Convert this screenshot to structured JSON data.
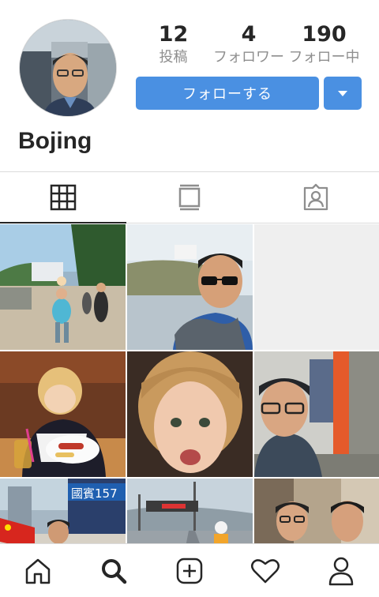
{
  "profile": {
    "username": "Bojing",
    "stats": [
      {
        "value": "12",
        "label": "投稿"
      },
      {
        "value": "4",
        "label": "フォロワー"
      },
      {
        "value": "190",
        "label": "フォロー中"
      }
    ],
    "follow_label": "フォローする"
  },
  "tabs": [
    "grid-icon",
    "feed-icon",
    "tagged-icon"
  ],
  "grid": {
    "photos": [
      {
        "name": "photo-park-child",
        "sign_text": ""
      },
      {
        "name": "photo-selfie-sunglasses",
        "sign_text": ""
      },
      {
        "name": "photo-empty",
        "sign_text": ""
      },
      {
        "name": "photo-child-eating",
        "sign_text": ""
      },
      {
        "name": "photo-child-face",
        "sign_text": ""
      },
      {
        "name": "photo-selfie-glasses",
        "sign_text": ""
      },
      {
        "name": "photo-city-flag",
        "sign_text": "國賓157"
      },
      {
        "name": "photo-bridge-road",
        "sign_text": ""
      },
      {
        "name": "photo-two-men",
        "sign_text": ""
      }
    ]
  },
  "bottom_nav": [
    "home-icon",
    "search-icon",
    "add-post-icon",
    "activity-heart-icon",
    "profile-icon"
  ],
  "colors": {
    "accent": "#4a90e2",
    "text": "#262626",
    "muted": "#8e8e8e",
    "divider": "#dbdbdb"
  }
}
